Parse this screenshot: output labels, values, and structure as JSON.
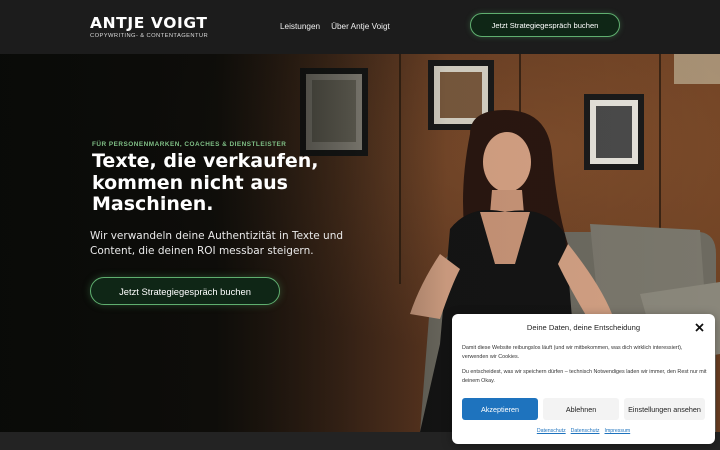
{
  "header": {
    "logo_title": "ANTJE VOIGT",
    "logo_subtitle": "COPYWRITING- & CONTENTAGENTUR",
    "nav": [
      {
        "label": "Leistungen"
      },
      {
        "label": "Über Antje Voigt"
      }
    ],
    "cta_label": "Jetzt Strategiegespräch buchen"
  },
  "hero": {
    "kicker": "FÜR PERSONENMARKEN, COACHES & DIENSTLEISTER",
    "title": "Texte, die verkaufen, kommen nicht aus Maschinen.",
    "text": "Wir verwandeln deine Authentizität in Texte und Content, die deinen ROI messbar steigern.",
    "cta_label": "Jetzt Strategiegespräch buchen"
  },
  "consent": {
    "title": "Deine Daten, deine Entscheidung",
    "text1": "Damit diese Website reibungslos läuft (und wir mitbekommen, was dich wirklich interessiert), verwenden wir Cookies.",
    "text2": "Du entscheidest, was wir speichern dürfen – technisch Notwendiges laden wir immer, den Rest nur mit deinem Okay.",
    "accept_label": "Akzeptieren",
    "deny_label": "Ablehnen",
    "settings_label": "Einstellungen ansehen",
    "links": [
      {
        "label": "Datenschutz"
      },
      {
        "label": "Datenschutz"
      },
      {
        "label": "Impressum"
      }
    ]
  },
  "colors": {
    "accent_green": "#5fae6f",
    "button_dark_green": "#0f2616",
    "accept_blue": "#1e73be",
    "header_bg": "#1c1c1c"
  },
  "icons": {
    "close": "close-icon"
  }
}
